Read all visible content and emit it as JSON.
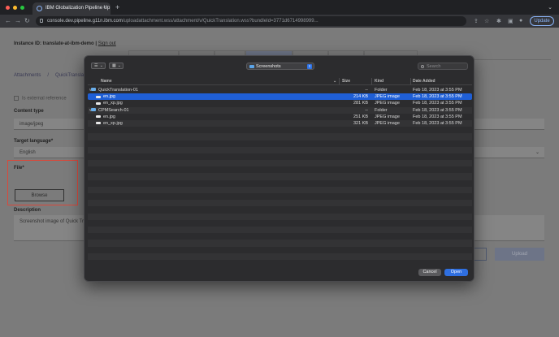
{
  "browser": {
    "tab_title": "IBM Globalization Pipeline Up",
    "new_tab": "+",
    "url_host": "console.dev.pipeline.g11n.ibm.com",
    "url_path": "/uploadattachment.wss/attachment/v/QuickTranslation.wss?bundleId=3771d6714998999...",
    "update_label": "Update"
  },
  "page": {
    "instance_label": "Instance ID: translate-at-ibm-demo",
    "sign_out": "Sign out",
    "breadcrumb": [
      "Attachments",
      "QuickTranslat"
    ],
    "breadcrumb_sep": "/",
    "external_ref_label": "Is external reference",
    "content_type_label": "Content type",
    "content_type_value": "image/jpeg",
    "target_language_label": "Target language*",
    "target_language_value": "English",
    "file_label": "File*",
    "browse_label": "Browse",
    "description_label": "Description",
    "description_value": "Screenshot image of Quick Tra",
    "upload_label": "Upload"
  },
  "dialog": {
    "location": "Screenshots",
    "search_placeholder": "Search",
    "columns": {
      "name": "Name",
      "size": "Size",
      "kind": "Kind",
      "date": "Date Added"
    },
    "rows": [
      {
        "name": "QuickTranslation-01",
        "size": "--",
        "kind": "Folder",
        "date": "Feb 18, 2023 at 3:55 PM",
        "icon": "folder-icon",
        "disclosure": "v",
        "indent": 0,
        "selected": false
      },
      {
        "name": "en.jpg",
        "size": "214 KB",
        "kind": "JPEG image",
        "date": "Feb 18, 2023 at 3:55 PM",
        "icon": "image-file-icon",
        "indent": 1,
        "selected": true
      },
      {
        "name": "en_xp.jpg",
        "size": "281 KB",
        "kind": "JPEG image",
        "date": "Feb 18, 2023 at 3:55 PM",
        "icon": "image-file-icon",
        "indent": 1,
        "selected": false
      },
      {
        "name": "CPMSearch-01",
        "size": "--",
        "kind": "Folder",
        "date": "Feb 18, 2023 at 3:55 PM",
        "icon": "folder-icon",
        "disclosure": "v",
        "indent": 0,
        "selected": false
      },
      {
        "name": "en.jpg",
        "size": "251 KB",
        "kind": "JPEG image",
        "date": "Feb 18, 2023 at 3:55 PM",
        "icon": "image-file-icon",
        "indent": 1,
        "selected": false
      },
      {
        "name": "en_xp.jpg",
        "size": "321 KB",
        "kind": "JPEG image",
        "date": "Feb 18, 2023 at 3:55 PM",
        "icon": "image-file-icon",
        "indent": 1,
        "selected": false
      }
    ],
    "cancel_label": "Cancel",
    "open_label": "Open"
  },
  "colors": {
    "selection": "#1f5fd6",
    "primary_button": "#2f6fe0",
    "highlight_box": "#d9483b"
  }
}
